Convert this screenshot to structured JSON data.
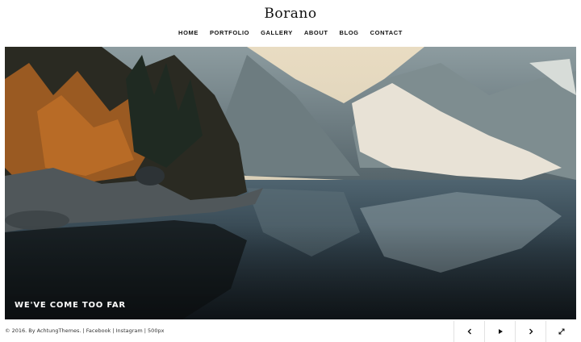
{
  "site": {
    "title": "Borano"
  },
  "nav": {
    "items": [
      "HOME",
      "PORTFOLIO",
      "GALLERY",
      "ABOUT",
      "BLOG",
      "CONTACT"
    ]
  },
  "hero": {
    "caption": "WE'VE COME TOO FAR"
  },
  "footer": {
    "copyright": "© 2016. By AchtungThemes.",
    "sep1": " | ",
    "facebook": "Facebook",
    "sep2": " | ",
    "instagram": "Instagram",
    "sep3": " | ",
    "px500": "500px"
  },
  "controls": {
    "icons": [
      "chevron-left-icon",
      "play-icon",
      "chevron-right-icon",
      "fullscreen-icon"
    ]
  }
}
